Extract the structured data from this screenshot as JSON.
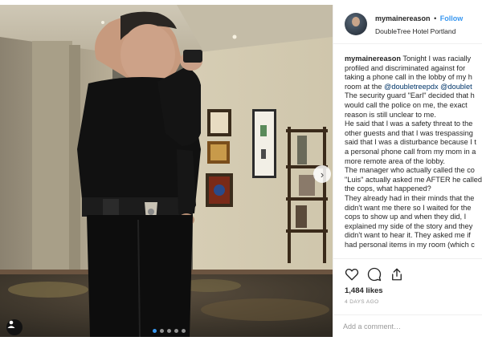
{
  "header": {
    "username": "mymainereason",
    "separator": "•",
    "follow_label": "Follow",
    "location": "DoubleTree Hotel Portland"
  },
  "caption": {
    "username": "mymainereason",
    "line1": " Tonight I was racially",
    "line2": "profiled and discriminated against for",
    "line3": "taking a phone call in the lobby of my h",
    "line4_pre": "room at the ",
    "mention1": "@doubletreepdx",
    "line4_mid": " ",
    "mention2": "@doublet",
    "line5": "The security guard \"Earl\" decided that h",
    "line6": "would call the police on me, the exact",
    "line7": "reason is still unclear to me.",
    "line8": "He said that I was a safety threat to the",
    "line9": "other guests and that I was trespassing",
    "line10": "said that I was a disturbance because I t",
    "line11": "a personal phone call from my mom in a",
    "line12": "more remote area of the lobby.",
    "line13": "The manager who actually called the co",
    "line14": "\"Luis\" actually asked me AFTER he called",
    "line15": "the cops, what happened?",
    "line16": "They already had in their minds that the",
    "line17": "didn't want me there so I waited for the",
    "line18": "cops to show up and when they did, I",
    "line19": "explained my side of the story and they",
    "line20": "didn't want to hear it. They asked me if",
    "line21": "had personal items in my room (which c"
  },
  "actions": {
    "like_icon": "heart-icon",
    "comment_icon": "comment-icon",
    "share_icon": "share-icon",
    "likes_text": "1,484 likes",
    "time_text": "4 DAYS AGO"
  },
  "comment": {
    "placeholder": "Add a comment…"
  },
  "media": {
    "carousel_total": 5,
    "carousel_active": 1,
    "next_icon": "chevron-right-icon",
    "user_tag_icon": "user-tag-icon"
  }
}
